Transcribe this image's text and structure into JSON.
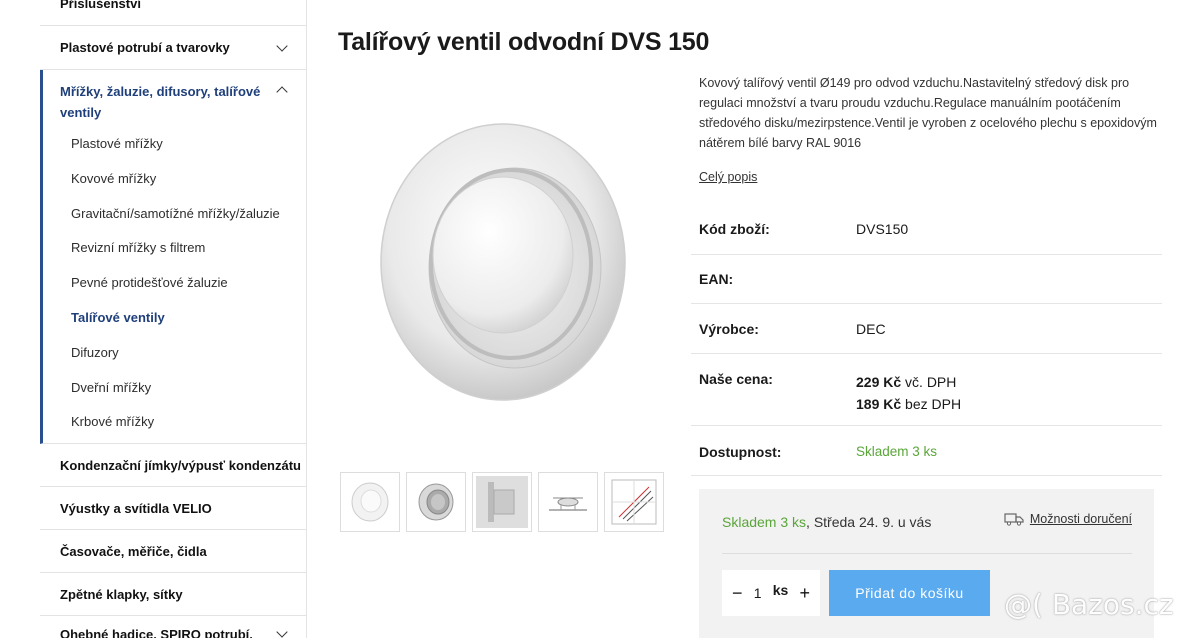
{
  "sidebar": {
    "top_category": "Příslušenství",
    "categories_before": [
      {
        "label": "Plastové potrubí a tvarovky"
      }
    ],
    "open_category": {
      "label": "Mřížky, žaluzie, difusory, talířové ventily",
      "items": [
        {
          "label": "Plastové mřížky"
        },
        {
          "label": "Kovové mřížky"
        },
        {
          "label": "Gravitační/samotížné mřížky/žaluzie"
        },
        {
          "label": "Revizní mřížky s filtrem"
        },
        {
          "label": "Pevné protidešťové žaluzie"
        },
        {
          "label": "Talířové ventily",
          "active": true
        },
        {
          "label": "Difuzory"
        },
        {
          "label": "Dveřní mřížky"
        },
        {
          "label": "Krbové mřížky"
        }
      ]
    },
    "categories_after": [
      {
        "label": "Kondenzační jímky/výpusť kondenzátu"
      },
      {
        "label": "Výustky a svítidla VELIO"
      },
      {
        "label": "Časovače, měřiče, čidla"
      },
      {
        "label": "Zpětné klapky, sítky"
      },
      {
        "label": "Ohebné hadice, SPIRO potrubí,"
      }
    ]
  },
  "product": {
    "title": "Talířový ventil odvodní DVS 150",
    "description": "Kovový talířový ventil Ø149 pro odvod vzduchu.Nastavitelný středový disk pro regulaci množství a tvaru proudu vzduchu.Regulace manuálním pootáčením středového disku/mezirpstence.Ventil je vyroben z ocelového plechu s epoxidovým nátěrem bílé barvy RAL 9016",
    "full_description_link": "Celý popis",
    "params": {
      "code_label": "Kód zboží:",
      "code_value": "DVS150",
      "ean_label": "EAN:",
      "ean_value": "",
      "maker_label": "Výrobce:",
      "maker_value": "DEC",
      "price_label": "Naše cena:",
      "price_vat_amount": "229 Kč",
      "price_vat_suffix": " vč. DPH",
      "price_novat_amount": "189 Kč",
      "price_novat_suffix": " bez DPH",
      "availability_label": "Dostupnost:",
      "availability_value": "Skladem 3 ks"
    }
  },
  "buybox": {
    "stock": "Skladem 3 ks",
    "delivery_date": ", Středa 24. 9. u vás",
    "delivery_options": "Možnosti doručení",
    "qty_minus": "−",
    "qty_value": "1",
    "qty_unit": "ks",
    "qty_plus": "+",
    "add_to_cart": "Přidat do košíku"
  },
  "watermark": "@( Bazos.cz",
  "colors": {
    "accent_blue": "#1f3f7a",
    "stock_green": "#5aa53a",
    "button_blue": "#5aaaf0"
  }
}
